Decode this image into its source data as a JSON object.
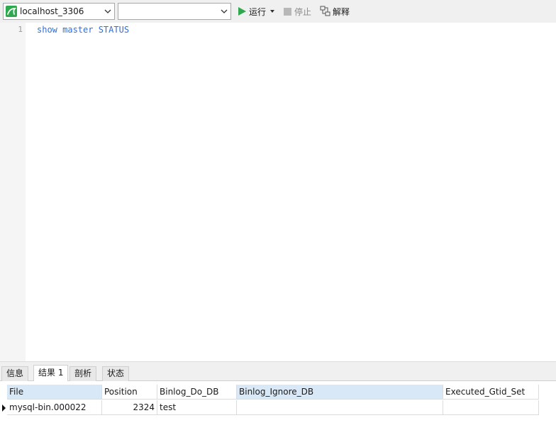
{
  "toolbar": {
    "connection": "localhost_3306",
    "database": "",
    "run_label": "运行",
    "stop_label": "停止",
    "explain_label": "解释"
  },
  "editor": {
    "line_number": "1",
    "code": "show master STATUS"
  },
  "tabs": [
    {
      "label": "信息",
      "active": false
    },
    {
      "label": "结果 1",
      "active": true
    },
    {
      "label": "剖析",
      "active": false
    },
    {
      "label": "状态",
      "active": false
    }
  ],
  "grid": {
    "columns": [
      "File",
      "Position",
      "Binlog_Do_DB",
      "Binlog_Ignore_DB",
      "Executed_Gtid_Set"
    ],
    "rows": [
      [
        "mysql-bin.000022",
        "2324",
        "test",
        "",
        ""
      ]
    ]
  },
  "colors": {
    "accent_green": "#2fa84f",
    "code_blue": "#2f6fd6",
    "header_highlight": "#d8e8f7"
  }
}
